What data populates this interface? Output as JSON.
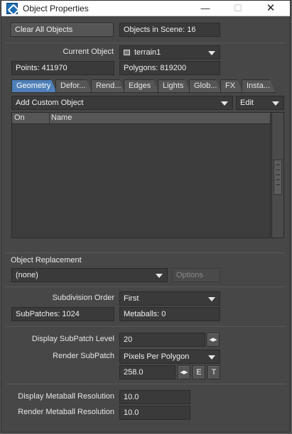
{
  "window": {
    "title": "Object Properties"
  },
  "header": {
    "clear_all_label": "Clear All Objects",
    "objects_in_scene": "Objects in Scene: 16"
  },
  "current_object": {
    "label": "Current Object",
    "value": "terrain1",
    "points": "Points: 411970",
    "polygons": "Polygons: 819200"
  },
  "tabs": [
    "Geometry",
    "Defor...",
    "Rend...",
    "Edges",
    "Lights",
    "Glob...",
    "FX",
    "Insta..."
  ],
  "custom_object": {
    "add_label": "Add Custom Object",
    "edit_label": "Edit",
    "columns": [
      "On",
      "Name"
    ]
  },
  "replacement": {
    "title": "Object Replacement",
    "value": "(none)",
    "options_label": "Options"
  },
  "subdivision": {
    "order_label": "Subdivision Order",
    "order_value": "First",
    "subpatches": "SubPatches: 1024",
    "metaballs": "Metaballs: 0",
    "display_label": "Display SubPatch Level",
    "display_value": "20",
    "render_label": "Render SubPatch",
    "render_mode": "Pixels Per Polygon",
    "render_value": "258.0",
    "e_label": "E",
    "t_label": "T"
  },
  "metaball": {
    "display_label": "Display Metaball Resolution",
    "display_value": "10.0",
    "render_label": "Render Metaball Resolution",
    "render_value": "10.0"
  }
}
